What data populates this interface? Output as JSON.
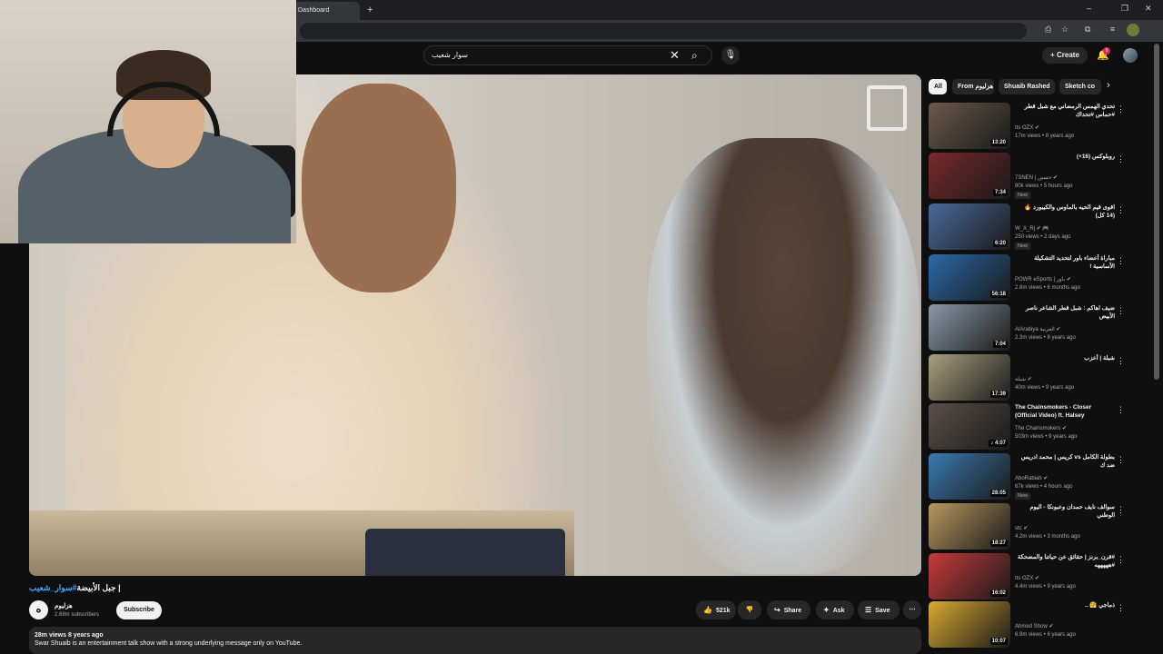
{
  "browser": {
    "tab_title": "Dashboard",
    "new_tab_icon": "+",
    "window_controls": [
      "–",
      "❐",
      "✕"
    ]
  },
  "header": {
    "search_value": "سوار شعيب",
    "create_label": "Create",
    "notification_count": "9"
  },
  "video": {
    "title_prefix": "جبل الأبيضة",
    "title_hashtag": "#سوار_شعيب",
    "title_suffix": " |",
    "channel_name": "هزليوم",
    "channel_logo": "ه",
    "subscribers": "2.69m subscribers",
    "subscribe_label": "Subscribe",
    "likes": "521k",
    "share_label": "Share",
    "ask_label": "Ask",
    "save_label": "Save",
    "views_meta": "28m views  8 years ago",
    "description": "Swar Shuaib is an entertainment talk show with a strong underlying message only on YouTube."
  },
  "chips": [
    "All",
    "From هزليوم",
    "Shuaib Rashed",
    "Sketch co"
  ],
  "recommendations": [
    {
      "title": "تحدي الهمس الرمضاني مع شبل قطر #حماس #تحداك",
      "channel": "Its OZX ✔",
      "stats": "17m views • 8 years ago",
      "duration": "13:20",
      "new": "",
      "thumb": "#6a5a4a"
    },
    {
      "title": "روبلوكس (16+)",
      "channel": "7SNEN | حسين ✔",
      "stats": "80k views • 5 hours ago",
      "duration": "7:34",
      "new": "New",
      "thumb": "#7a2a2a"
    },
    {
      "title": "اقوى قيم الحيه بالماوس والكيبورد 🔥 (14 كل)",
      "channel": "W_X_Rj ✔ 🎮",
      "stats": "250 views • 2 days ago",
      "duration": "6:20",
      "new": "New",
      "thumb": "#4a6a9a"
    },
    {
      "title": "مباراة أعضاء باور لتحديد التشكيلة الأساسية !",
      "channel": "POWR eSports | باور ✔",
      "stats": "2.8m views • 6 months ago",
      "duration": "56:18",
      "new": "",
      "thumb": "#2a6aa8"
    },
    {
      "title": "ضيف اهاكم : شبل قطر الشاعر ناصر الأبيض",
      "channel": "AlArabiya العربية ✔",
      "stats": "2.3m views • 8 years ago",
      "duration": "7:04",
      "new": "",
      "thumb": "#8a9aa8"
    },
    {
      "title": "شبلة | أعزب",
      "channel": "شبلة ✔",
      "stats": "40m views • 9 years ago",
      "duration": "17:39",
      "new": "",
      "thumb": "#a8a080"
    },
    {
      "title": "The Chainsmokers - Closer (Official Video) ft. Halsey",
      "channel": "The Chainsmokers ✔",
      "stats": "503m views • 9 years ago",
      "duration": "♪ 4:07",
      "new": "",
      "thumb": "#5a5048"
    },
    {
      "title": "بطولة الكامل vs كريس | محمد ادريس ضد ك",
      "channel": "AboRabiah ✔",
      "stats": "67k views • 4 hours ago",
      "duration": "28:05",
      "new": "New",
      "thumb": "#3a7ab0"
    },
    {
      "title": "سوالف نايف حمدان وعبونكا - اليوم الوطني",
      "channel": "stc ✔",
      "stats": "4.2m views • 3 months ago",
      "duration": "18:27",
      "new": "",
      "thumb": "#b89860"
    },
    {
      "title": "#قرن_برنز | حقائق عن حياتنا والمضحكة #هههههه",
      "channel": "Its OZX ✔",
      "stats": "4.4m views • 9 years ago",
      "duration": "16:02",
      "new": "",
      "thumb": "#c83a3a"
    },
    {
      "title": "ذماجي 🤗 ..",
      "channel": "Ahmed Show ✔",
      "stats": "6.9m views • 6 years ago",
      "duration": "10:07",
      "new": "",
      "thumb": "#d8a830"
    }
  ]
}
